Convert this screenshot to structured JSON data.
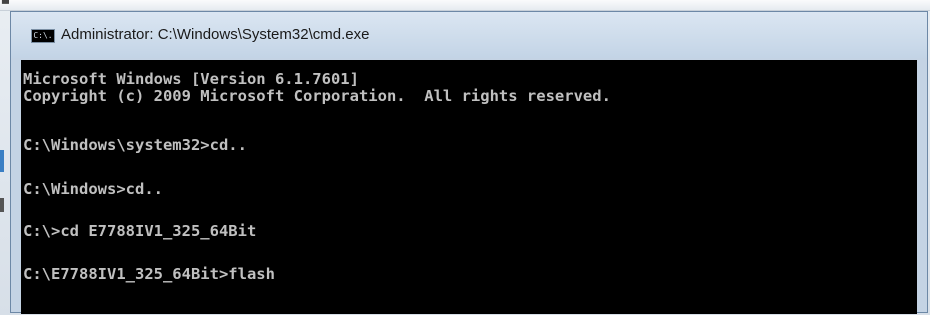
{
  "window": {
    "title": "Administrator: C:\\Windows\\System32\\cmd.exe",
    "icon": "cmd-icon",
    "icon_text": "C:\\."
  },
  "console": {
    "lines": [
      "Microsoft Windows [Version 6.1.7601]",
      "Copyright (c) 2009 Microsoft Corporation.  All rights reserved.",
      "C:\\Windows\\system32>cd..",
      "C:\\Windows>cd..",
      "C:\\>cd E7788IV1_325_64Bit",
      "C:\\E7788IV1_325_64Bit>flash"
    ]
  },
  "colors": {
    "console_bg": "#000000",
    "console_fg": "#c0c0c0",
    "title_bar": "#c3d4e6"
  }
}
